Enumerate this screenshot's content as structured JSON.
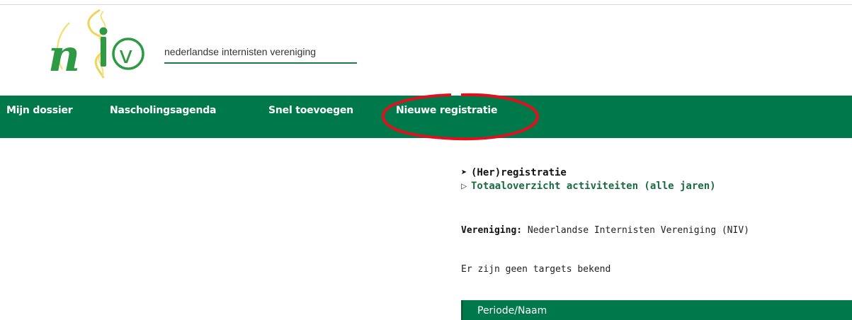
{
  "brand": {
    "logo_text": "niv",
    "tagline": "nederlandse internisten vereniging",
    "colors": {
      "green": "#00794a",
      "yellow": "#f4dc63",
      "annotation": "#e0101e"
    }
  },
  "nav": {
    "items": [
      {
        "label": "Mijn dossier"
      },
      {
        "label": "Nascholingsagenda"
      },
      {
        "label": "Snel toevoegen"
      },
      {
        "label": "Nieuwe registratie"
      }
    ]
  },
  "content": {
    "links": [
      {
        "arrow": "➤",
        "label": "(Her)registratie"
      },
      {
        "arrow": "▷",
        "label": "Totaaloverzicht activiteiten (alle jaren)"
      }
    ],
    "vereniging_label": "Vereniging:",
    "vereniging_value": "Nederlandse Internisten Vereniging (NIV)",
    "targets_text": "Er zijn geen targets bekend",
    "table": {
      "columns": [
        "Periode/Naam"
      ]
    }
  }
}
